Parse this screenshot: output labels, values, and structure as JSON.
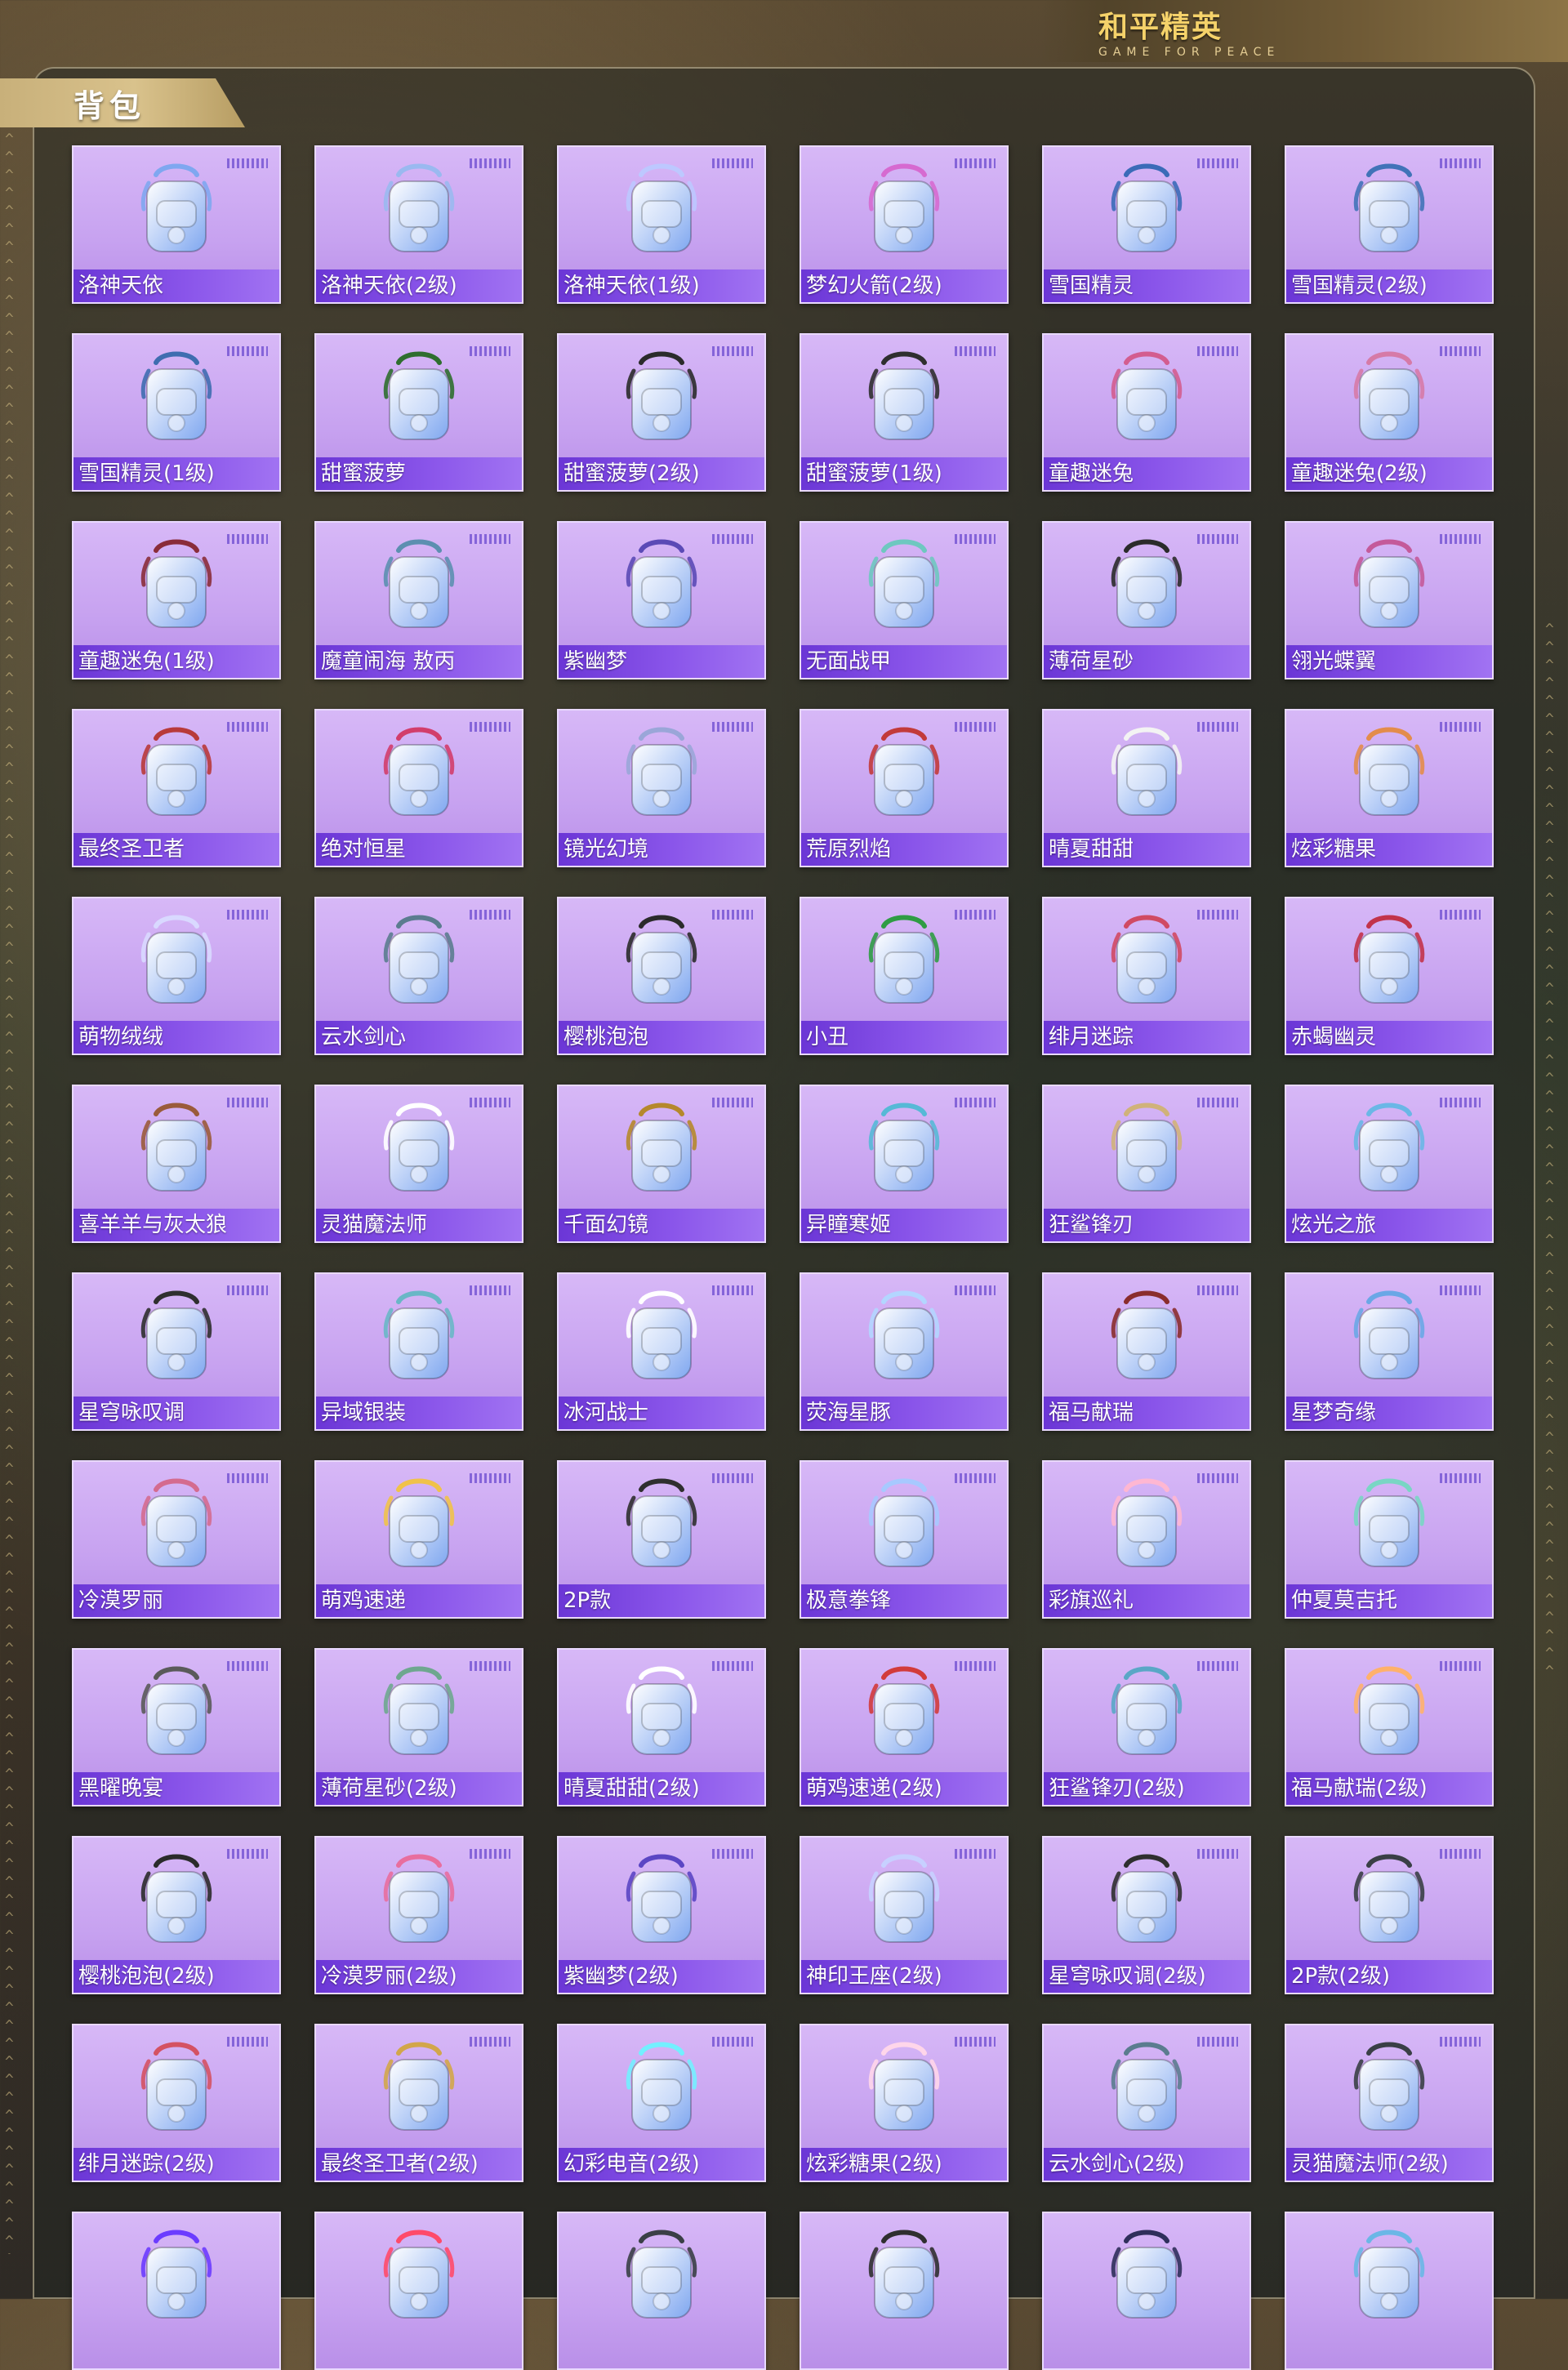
{
  "brand": {
    "title_zh": "和平精英",
    "title_en": "GAME FOR PEACE"
  },
  "section": {
    "title": "背包"
  },
  "items": [
    {
      "label": "洛神天依",
      "icon": "backpack-icon",
      "colors": [
        "#ffffff",
        "#7fa7f0"
      ]
    },
    {
      "label": "洛神天依(2级)",
      "icon": "backpack-icon",
      "colors": [
        "#f4f8ff",
        "#9ab9f0"
      ]
    },
    {
      "label": "洛神天依(1级)",
      "icon": "backpack-icon",
      "colors": [
        "#ffffff",
        "#bdc8ff"
      ]
    },
    {
      "label": "梦幻火箭(2级)",
      "icon": "backpack-icon",
      "colors": [
        "#3b3450",
        "#d66ad0"
      ]
    },
    {
      "label": "雪国精灵",
      "icon": "backpack-icon",
      "colors": [
        "#f4f4f4",
        "#3b6bb8"
      ]
    },
    {
      "label": "雪国精灵(2级)",
      "icon": "backpack-icon",
      "colors": [
        "#f4f4f4",
        "#4173b8"
      ]
    },
    {
      "label": "雪国精灵(1级)",
      "icon": "backpack-icon",
      "colors": [
        "#ffffff",
        "#3f6db0"
      ]
    },
    {
      "label": "甜蜜菠萝",
      "icon": "backpack-icon",
      "colors": [
        "#f2d11b",
        "#2f6e2f"
      ]
    },
    {
      "label": "甜蜜菠萝(2级)",
      "icon": "backpack-icon",
      "colors": [
        "#f5d332",
        "#2b2b2b"
      ]
    },
    {
      "label": "甜蜜菠萝(1级)",
      "icon": "backpack-icon",
      "colors": [
        "#f0c937",
        "#2f2f2f"
      ]
    },
    {
      "label": "童趣迷兔",
      "icon": "backpack-icon",
      "colors": [
        "#ffffff",
        "#d35d8f"
      ]
    },
    {
      "label": "童趣迷兔(2级)",
      "icon": "backpack-icon",
      "colors": [
        "#fff6fb",
        "#d67aa7"
      ]
    },
    {
      "label": "童趣迷兔(1级)",
      "icon": "backpack-icon",
      "colors": [
        "#ffffff",
        "#8a2d3a"
      ]
    },
    {
      "label": "魔童闹海 敖丙",
      "icon": "backpack-icon",
      "colors": [
        "#d9f2ff",
        "#5c8fb0"
      ]
    },
    {
      "label": "紫幽梦",
      "icon": "backpack-icon",
      "colors": [
        "#a79ce5",
        "#5b4ab6"
      ]
    },
    {
      "label": "无面战甲",
      "icon": "backpack-icon",
      "colors": [
        "#2f3032",
        "#6ec8c0"
      ]
    },
    {
      "label": "薄荷星砂",
      "icon": "backpack-icon",
      "colors": [
        "#d8f6e8",
        "#2b2b2b"
      ]
    },
    {
      "label": "翎光蝶翼",
      "icon": "backpack-icon",
      "colors": [
        "#f5d6e7",
        "#c45a9a"
      ]
    },
    {
      "label": "最终圣卫者",
      "icon": "backpack-icon",
      "colors": [
        "#ffffff",
        "#b83a3a"
      ]
    },
    {
      "label": "绝对恒星",
      "icon": "backpack-icon",
      "colors": [
        "#ffd2e2",
        "#d23d6b"
      ]
    },
    {
      "label": "镜光幻境",
      "icon": "backpack-icon",
      "colors": [
        "#f7f7ff",
        "#9aa6d8"
      ]
    },
    {
      "label": "荒原烈焰",
      "icon": "backpack-icon",
      "colors": [
        "#3a1f1f",
        "#c23a3a"
      ]
    },
    {
      "label": "晴夏甜甜",
      "icon": "backpack-icon",
      "colors": [
        "#ffd1df",
        "#f3f3f3"
      ]
    },
    {
      "label": "炫彩糖果",
      "icon": "backpack-icon",
      "colors": [
        "#ffd6e8",
        "#e38c4b"
      ]
    },
    {
      "label": "萌物绒绒",
      "icon": "backpack-icon",
      "colors": [
        "#ffffff",
        "#d9d9ff"
      ]
    },
    {
      "label": "云水剑心",
      "icon": "backpack-icon",
      "colors": [
        "#b7d6e9",
        "#5b7c8f"
      ]
    },
    {
      "label": "樱桃泡泡",
      "icon": "backpack-icon",
      "colors": [
        "#ffd2e1",
        "#2b2b2b"
      ]
    },
    {
      "label": "小丑",
      "icon": "backpack-icon",
      "colors": [
        "#6a3cd6",
        "#2f9c44"
      ]
    },
    {
      "label": "绯月迷踪",
      "icon": "backpack-icon",
      "colors": [
        "#6b5a5a",
        "#d04a63"
      ]
    },
    {
      "label": "赤蝎幽灵",
      "icon": "backpack-icon",
      "colors": [
        "#2f2f2f",
        "#c2334a"
      ]
    },
    {
      "label": "喜羊羊与灰太狼",
      "icon": "backpack-icon",
      "colors": [
        "#fff3f8",
        "#9a5b3b"
      ]
    },
    {
      "label": "灵猫魔法师",
      "icon": "backpack-icon",
      "colors": [
        "#5b6d8f",
        "#ffffff"
      ]
    },
    {
      "label": "千面幻镜",
      "icon": "backpack-icon",
      "colors": [
        "#ffffff",
        "#b5882c"
      ]
    },
    {
      "label": "异瞳寒姬",
      "icon": "backpack-icon",
      "colors": [
        "#2b2f44",
        "#56b9d6"
      ]
    },
    {
      "label": "狂鲨锋刃",
      "icon": "backpack-icon",
      "colors": [
        "#2f3a3f",
        "#d0b27a"
      ]
    },
    {
      "label": "炫光之旅",
      "icon": "backpack-icon",
      "colors": [
        "#d7403c",
        "#6ab7e6"
      ]
    },
    {
      "label": "星穹咏叹调",
      "icon": "backpack-icon",
      "colors": [
        "#d6b27a",
        "#2f2f2f"
      ]
    },
    {
      "label": "异域银装",
      "icon": "backpack-icon",
      "colors": [
        "#3a3f46",
        "#69b7c6"
      ]
    },
    {
      "label": "冰河战士",
      "icon": "backpack-icon",
      "colors": [
        "#2f4b8f",
        "#ffffff"
      ]
    },
    {
      "label": "荧海星豚",
      "icon": "backpack-icon",
      "colors": [
        "#eef7ff",
        "#b3d6ff"
      ]
    },
    {
      "label": "福马献瑞",
      "icon": "backpack-icon",
      "colors": [
        "#e06a35",
        "#8a2d2d"
      ]
    },
    {
      "label": "星梦奇缘",
      "icon": "backpack-icon",
      "colors": [
        "#bfe6ff",
        "#6aa7e6"
      ]
    },
    {
      "label": "冷漠罗丽",
      "icon": "backpack-icon",
      "colors": [
        "#ffd6ea",
        "#d46b8f"
      ]
    },
    {
      "label": "萌鸡速递",
      "icon": "backpack-icon",
      "colors": [
        "#d53a2d",
        "#f0c24a"
      ]
    },
    {
      "label": "2P款",
      "icon": "backpack-icon",
      "colors": [
        "#ffffff",
        "#2f2f2f"
      ]
    },
    {
      "label": "极意拳锋",
      "icon": "backpack-icon",
      "colors": [
        "#fff1b8",
        "#a7c9ff"
      ]
    },
    {
      "label": "彩旗巡礼",
      "icon": "backpack-icon",
      "colors": [
        "#ffffff",
        "#ffb7d2"
      ]
    },
    {
      "label": "仲夏莫吉托",
      "icon": "backpack-icon",
      "colors": [
        "#ffffff",
        "#79d6c4"
      ]
    },
    {
      "label": "黑曜晚宴",
      "icon": "backpack-icon",
      "colors": [
        "#1f1f1f",
        "#5a5a5a"
      ]
    },
    {
      "label": "薄荷星砂(2级)",
      "icon": "backpack-icon",
      "colors": [
        "#d9f4e5",
        "#6ea78f"
      ]
    },
    {
      "label": "晴夏甜甜(2级)",
      "icon": "backpack-icon",
      "colors": [
        "#ffd7e6",
        "#ffffff"
      ]
    },
    {
      "label": "萌鸡速递(2级)",
      "icon": "backpack-icon",
      "colors": [
        "#ffffff",
        "#d23b3b"
      ]
    },
    {
      "label": "狂鲨锋刃(2级)",
      "icon": "backpack-icon",
      "colors": [
        "#2a2f35",
        "#5aa7c6"
      ]
    },
    {
      "label": "福马献瑞(2级)",
      "icon": "backpack-icon",
      "colors": [
        "#e25b2e",
        "#ffb16b"
      ]
    },
    {
      "label": "樱桃泡泡(2级)",
      "icon": "backpack-icon",
      "colors": [
        "#ffd2e5",
        "#2b2b2b"
      ]
    },
    {
      "label": "冷漠罗丽(2级)",
      "icon": "backpack-icon",
      "colors": [
        "#ffd7ea",
        "#e86e9e"
      ]
    },
    {
      "label": "紫幽梦(2级)",
      "icon": "backpack-icon",
      "colors": [
        "#b1a6ee",
        "#5b46c4"
      ]
    },
    {
      "label": "神印王座(2级)",
      "icon": "backpack-icon",
      "colors": [
        "#2f2f5b",
        "#c7d0ff"
      ]
    },
    {
      "label": "星穹咏叹调(2级)",
      "icon": "backpack-icon",
      "colors": [
        "#d3b07b",
        "#2f2f2f"
      ]
    },
    {
      "label": "2P款(2级)",
      "icon": "backpack-icon",
      "colors": [
        "#ffffff",
        "#3a3f46"
      ]
    },
    {
      "label": "绯月迷踪(2级)",
      "icon": "backpack-icon",
      "colors": [
        "#ffffff",
        "#d45263"
      ]
    },
    {
      "label": "最终圣卫者(2级)",
      "icon": "backpack-icon",
      "colors": [
        "#ffffff",
        "#d2a64a"
      ]
    },
    {
      "label": "幻彩电音(2级)",
      "icon": "backpack-icon",
      "colors": [
        "#3b3f8f",
        "#73f0ff"
      ]
    },
    {
      "label": "炫彩糖果(2级)",
      "icon": "backpack-icon",
      "colors": [
        "#f5b27a",
        "#ffd6ea"
      ]
    },
    {
      "label": "云水剑心(2级)",
      "icon": "backpack-icon",
      "colors": [
        "#bcd9ed",
        "#5b7c8f"
      ]
    },
    {
      "label": "灵猫魔法师(2级)",
      "icon": "backpack-icon",
      "colors": [
        "#ffffff",
        "#3a3f46"
      ]
    }
  ],
  "partial_row": [
    {
      "icon": "backpack-icon",
      "colors": [
        "#ffffff",
        "#6b3cff"
      ]
    },
    {
      "icon": "backpack-icon",
      "colors": [
        "#ffd6e8",
        "#ff4a6a"
      ]
    },
    {
      "icon": "backpack-icon",
      "colors": [
        "#ffffff",
        "#3a3f46"
      ]
    },
    {
      "icon": "backpack-icon",
      "colors": [
        "#f2f2f2",
        "#2f2f2f"
      ]
    },
    {
      "icon": "backpack-icon",
      "colors": [
        "#dbe6ff",
        "#2f2f5b"
      ]
    },
    {
      "icon": "backpack-icon",
      "colors": [
        "#2f2f2f",
        "#6ab7e6"
      ]
    }
  ],
  "decor": {
    "chevron": "^"
  }
}
